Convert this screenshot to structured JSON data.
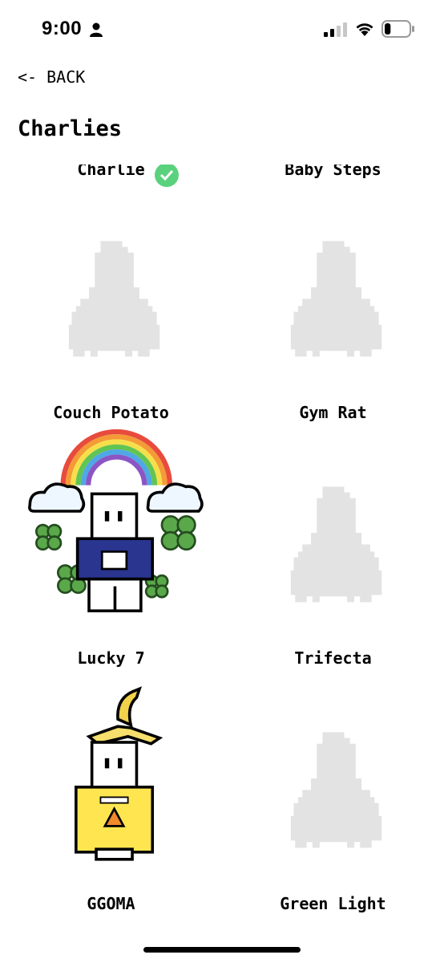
{
  "status_bar": {
    "time": "9:00",
    "battery_level": 0.25
  },
  "nav": {
    "back_label": "<- BACK"
  },
  "page_title": "Charlies",
  "partial_row": [
    {
      "name": "Charlie",
      "earned": true
    },
    {
      "name": "Baby Steps",
      "earned": false
    }
  ],
  "charlies": [
    {
      "name": "Couch Potato",
      "unlocked": false
    },
    {
      "name": "Gym Rat",
      "unlocked": false
    },
    {
      "name": "Lucky 7",
      "unlocked": true,
      "art": "rainbow-clover-charlie"
    },
    {
      "name": "Trifecta",
      "unlocked": false
    },
    {
      "name": "GGOMA",
      "unlocked": true,
      "art": "banana-charlie"
    },
    {
      "name": "Green Light",
      "unlocked": false
    }
  ],
  "colors": {
    "locked_silhouette": "#e3e3e3",
    "check_badge": "#5ad17d",
    "shirt_navy": "#2a3590",
    "overalls_yellow": "#ffe651",
    "clover": "#5aa84a"
  }
}
